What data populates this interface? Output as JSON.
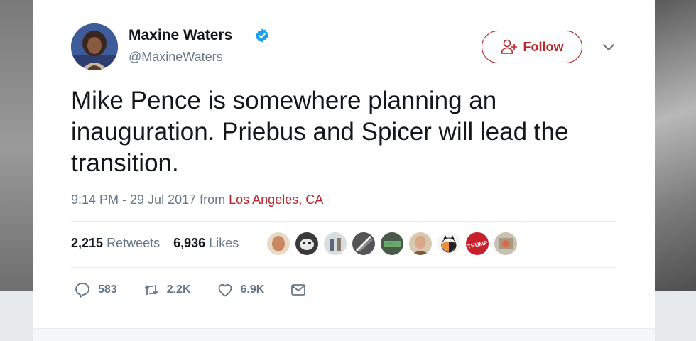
{
  "colors": {
    "accent": "#b8252b",
    "verified": "#1da1f2",
    "secondary_text": "#657786",
    "primary_text": "#14171a"
  },
  "author": {
    "name": "Maxine Waters",
    "handle": "@MaxineWaters",
    "verified_icon": "verified-badge-icon"
  },
  "follow_button": {
    "label": "Follow",
    "icon": "add-user-icon"
  },
  "tweet": {
    "text": "Mike Pence is somewhere planning an inauguration. Priebus and Spicer will lead the transition.",
    "timestamp": "9:14 PM - 29 Jul 2017",
    "from_label": "from",
    "location": "Los Angeles, CA"
  },
  "stats": {
    "retweets_count": "2,215",
    "retweets_label": "Retweets",
    "likes_count": "6,936",
    "likes_label": "Likes"
  },
  "likers_avatar_text": [
    "TRUMP"
  ],
  "actions": {
    "reply": {
      "icon": "reply-icon",
      "count": "583"
    },
    "retweet": {
      "icon": "retweet-icon",
      "count": "2.2K"
    },
    "like": {
      "icon": "heart-icon",
      "count": "6.9K"
    },
    "message": {
      "icon": "mail-icon"
    }
  }
}
